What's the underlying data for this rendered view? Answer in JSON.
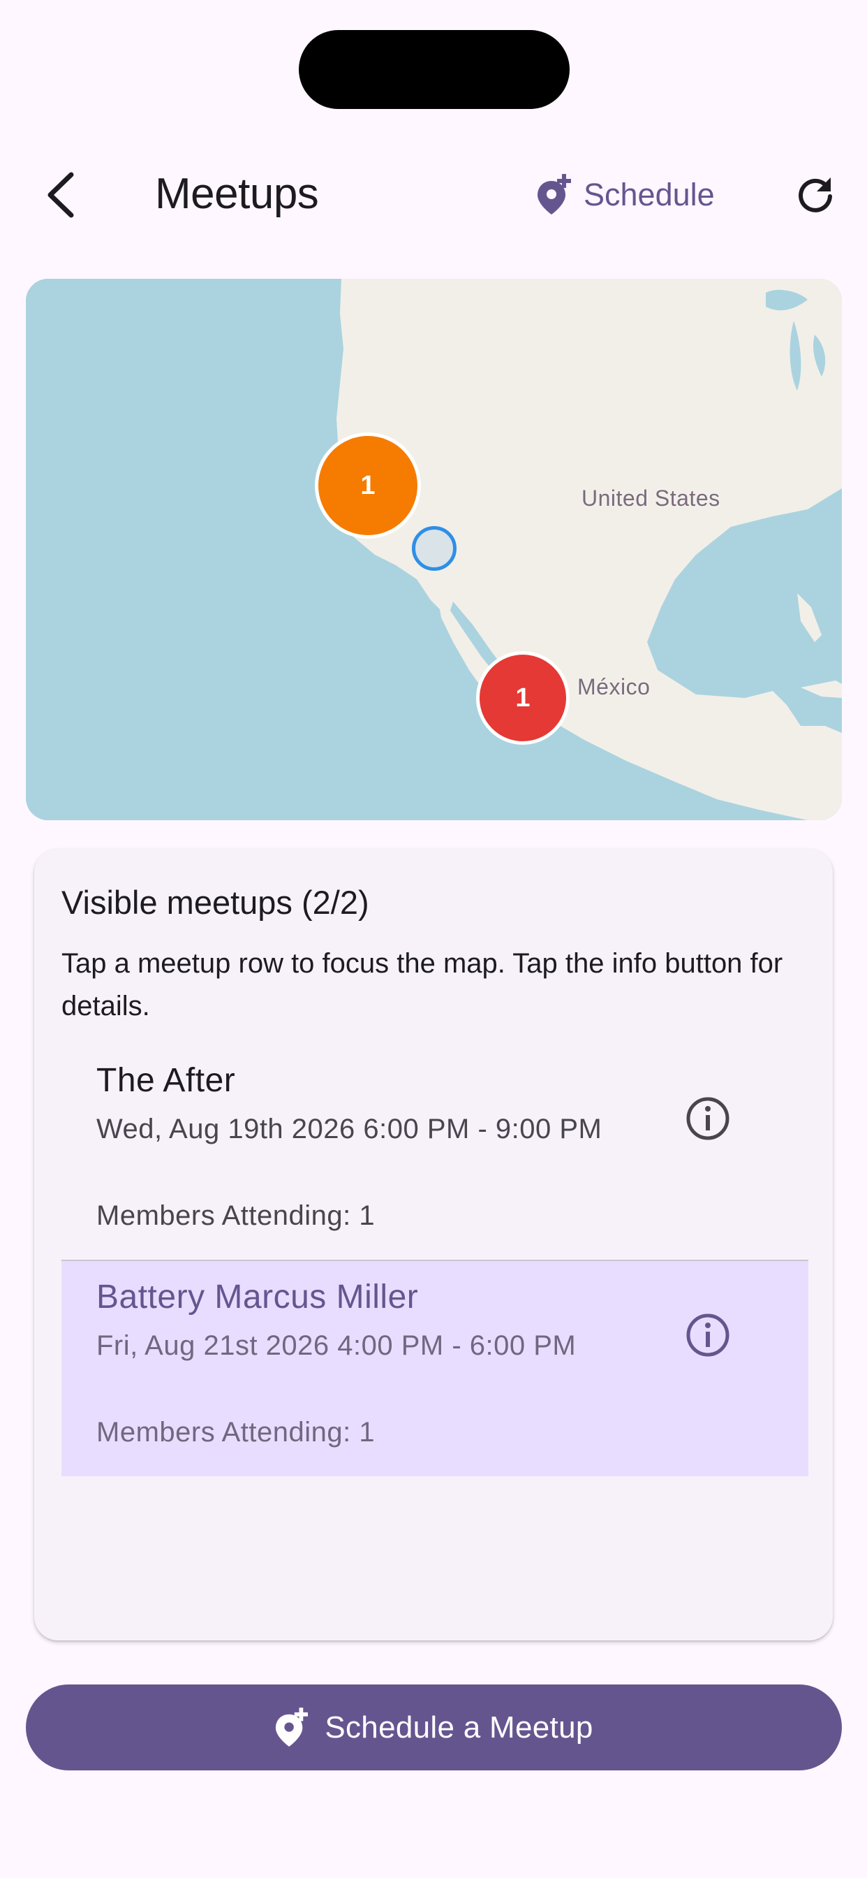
{
  "app_bar": {
    "title": "Meetups",
    "schedule_label": "Schedule"
  },
  "map": {
    "country_labels": [
      "United States",
      "México"
    ],
    "clusters": [
      {
        "count": "1",
        "color": "#f57c00"
      },
      {
        "count": "1",
        "color": "#e53935"
      }
    ]
  },
  "card": {
    "title": "Visible meetups (2/2)",
    "subtitle": "Tap a meetup row to focus the map. Tap the info button for details.",
    "meetups": [
      {
        "name": "The After",
        "time": "Wed, Aug 19th 2026 6:00 PM - 9:00 PM",
        "members": "Members Attending: 1"
      },
      {
        "name": "Battery Marcus Miller",
        "time": "Fri, Aug 21st 2026 4:00 PM - 6:00 PM",
        "members": "Members Attending: 1"
      }
    ]
  },
  "primary_button": {
    "label": "Schedule a Meetup"
  },
  "colors": {
    "accent": "#65558f",
    "selected_row": "#e9ddff",
    "background": "#fef7ff",
    "water": "#aad3df",
    "land": "#f2efe9"
  }
}
